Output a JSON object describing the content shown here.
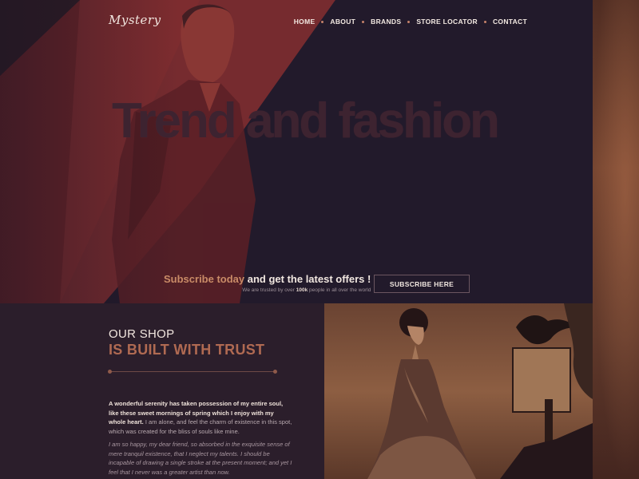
{
  "brand": {
    "logo": "Mystery"
  },
  "nav": {
    "items": [
      "HOME",
      "ABOUT",
      "BRANDS",
      "STORE LOCATOR",
      "CONTACT"
    ]
  },
  "hero": {
    "title": "Trend and fashion"
  },
  "subscribe": {
    "accent": "Subscribe today",
    "rest": " and get the latest offers !",
    "trust_prefix": "We are trusted by over ",
    "trust_number": "100k",
    "trust_suffix": " people in all over the world",
    "button_label": "SUBSCRIBE HERE"
  },
  "about": {
    "eyebrow": "OUR SHOP",
    "title": "IS BUILT WITH TRUST",
    "para1_strong": "A wonderful serenity has taken possession of my entire soul, like these sweet mornings of spring which I enjoy with my whole heart.",
    "para1_rest": " I am alone, and feel the charm of existence in this spot, which was created for the bliss of souls like mine.",
    "para2": "I am so happy, my dear friend, so absorbed in the exquisite sense of mere tranquil existence, that I neglect my talents. I should be incapable of drawing a single stroke at the present moment; and yet I feel that I never was a greater artist than now."
  },
  "colors": {
    "background": "#1e1726",
    "accent": "#c98b67",
    "title_accent": "#b06a52",
    "hero_red": "#7a2b2e"
  }
}
